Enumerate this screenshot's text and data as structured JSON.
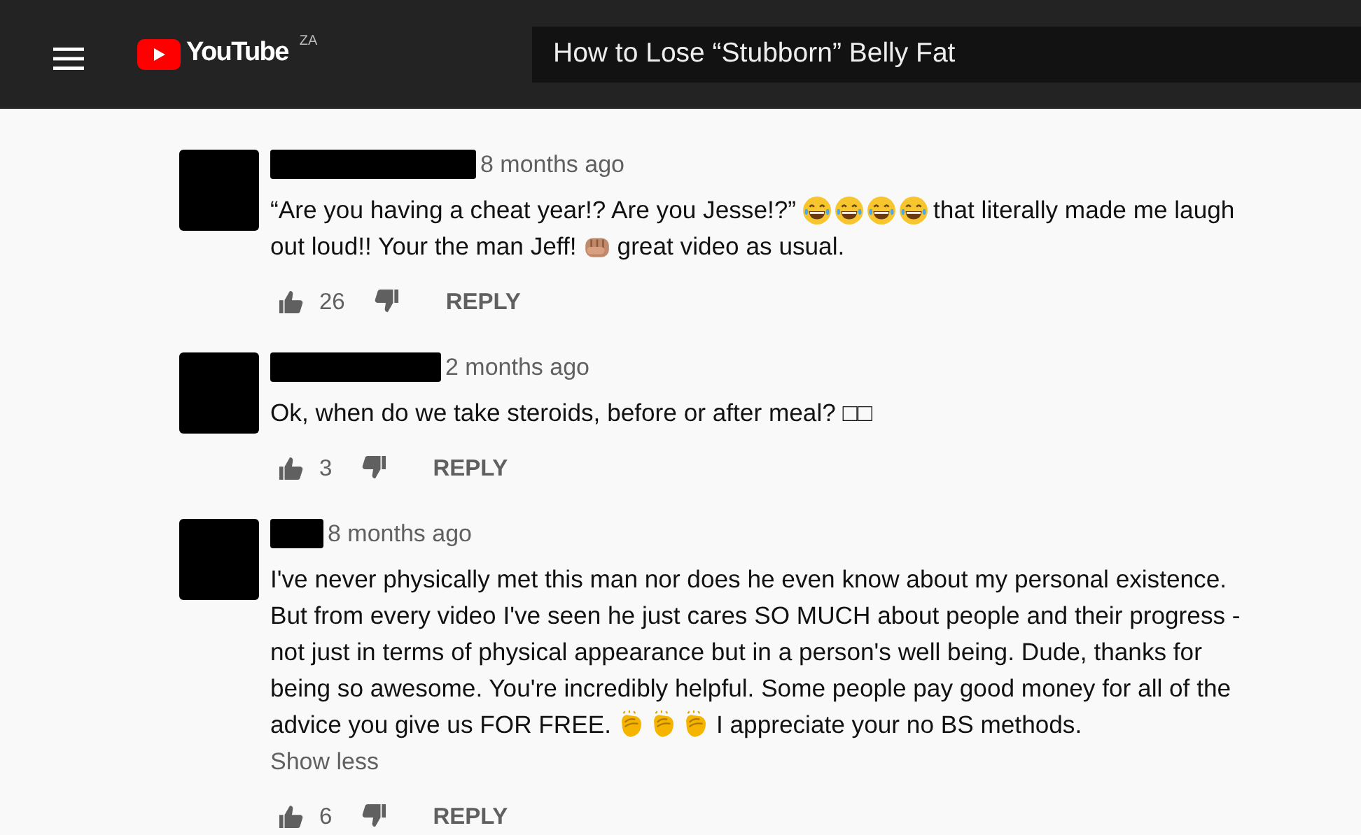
{
  "header": {
    "logo_text": "YouTube",
    "region": "ZA",
    "video_title": "How to Lose “Stubborn” Belly Fat"
  },
  "comments": [
    {
      "author_redacted": true,
      "time": "8 months ago",
      "lines": [
        [
          {
            "kind": "text",
            "text": "“Are you having a cheat year!? Are you Jesse!?”"
          },
          {
            "kind": "laugh-emoji"
          },
          {
            "kind": "laugh-emoji"
          },
          {
            "kind": "laugh-emoji"
          },
          {
            "kind": "laugh-emoji"
          },
          {
            "kind": "text",
            "text": "that literally made me laugh"
          }
        ],
        [
          {
            "kind": "text",
            "text": "out loud!! Your the man Jeff!"
          },
          {
            "kind": "fist-emoji"
          },
          {
            "kind": "text",
            "text": "great video as usual."
          }
        ]
      ],
      "likes": "26",
      "reply": "REPLY"
    },
    {
      "author_redacted": true,
      "time": "2 months ago",
      "lines": [
        [
          {
            "kind": "text",
            "text": "Ok, when do we take steroids, before or after meal? □□"
          }
        ]
      ],
      "likes": "3",
      "reply": "REPLY"
    },
    {
      "author_redacted": true,
      "time": "8 months ago",
      "lines": [
        [
          {
            "kind": "text",
            "text": "I've never physically met this man nor does he even know about my personal existence."
          }
        ],
        [
          {
            "kind": "text",
            "text": "But from every video I've seen he just cares SO MUCH about people and their progress -"
          }
        ],
        [
          {
            "kind": "text",
            "text": "not just in terms of physical appearance but in a person's well being. Dude, thanks for"
          }
        ],
        [
          {
            "kind": "text",
            "text": "being so awesome. You're incredibly helpful. Some people pay good money for all of the"
          }
        ],
        [
          {
            "kind": "text",
            "text": "advice you give us FOR FREE."
          },
          {
            "kind": "clap-emoji"
          },
          {
            "kind": "clap-emoji"
          },
          {
            "kind": "clap-emoji"
          },
          {
            "kind": "text",
            "text": "I appreciate your no BS methods."
          }
        ]
      ],
      "show_less": "Show less",
      "likes": "6",
      "reply": "REPLY"
    }
  ]
}
